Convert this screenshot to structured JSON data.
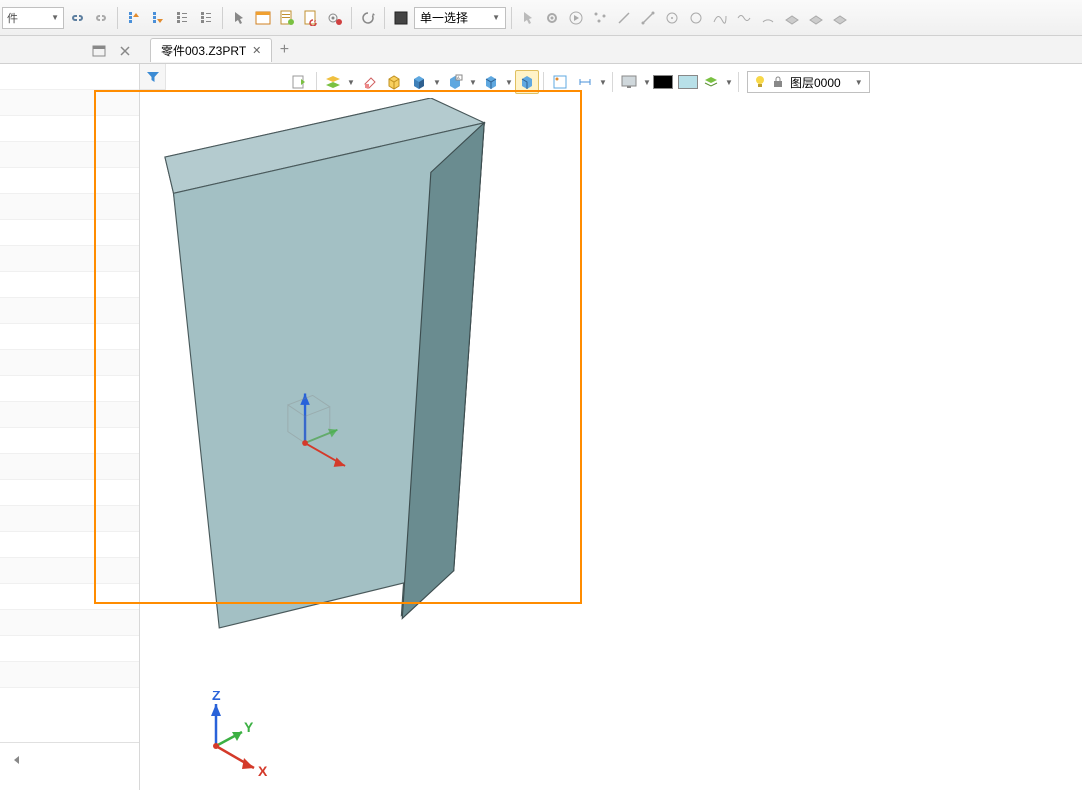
{
  "top": {
    "leftDropdown": "件",
    "selectionFilterLabel": "单一选择"
  },
  "tabs": {
    "active": "零件003.Z3PRT"
  },
  "viewToolbar": {
    "layerLabel": "图层0000"
  },
  "axis": {
    "x": "X",
    "y": "Y",
    "z": "Z"
  },
  "colors": {
    "highlight": "#ff8c00",
    "solidFront": "#a6c2c6",
    "solidTop": "#b7cdd0",
    "solidSide": "#6d8f93"
  }
}
